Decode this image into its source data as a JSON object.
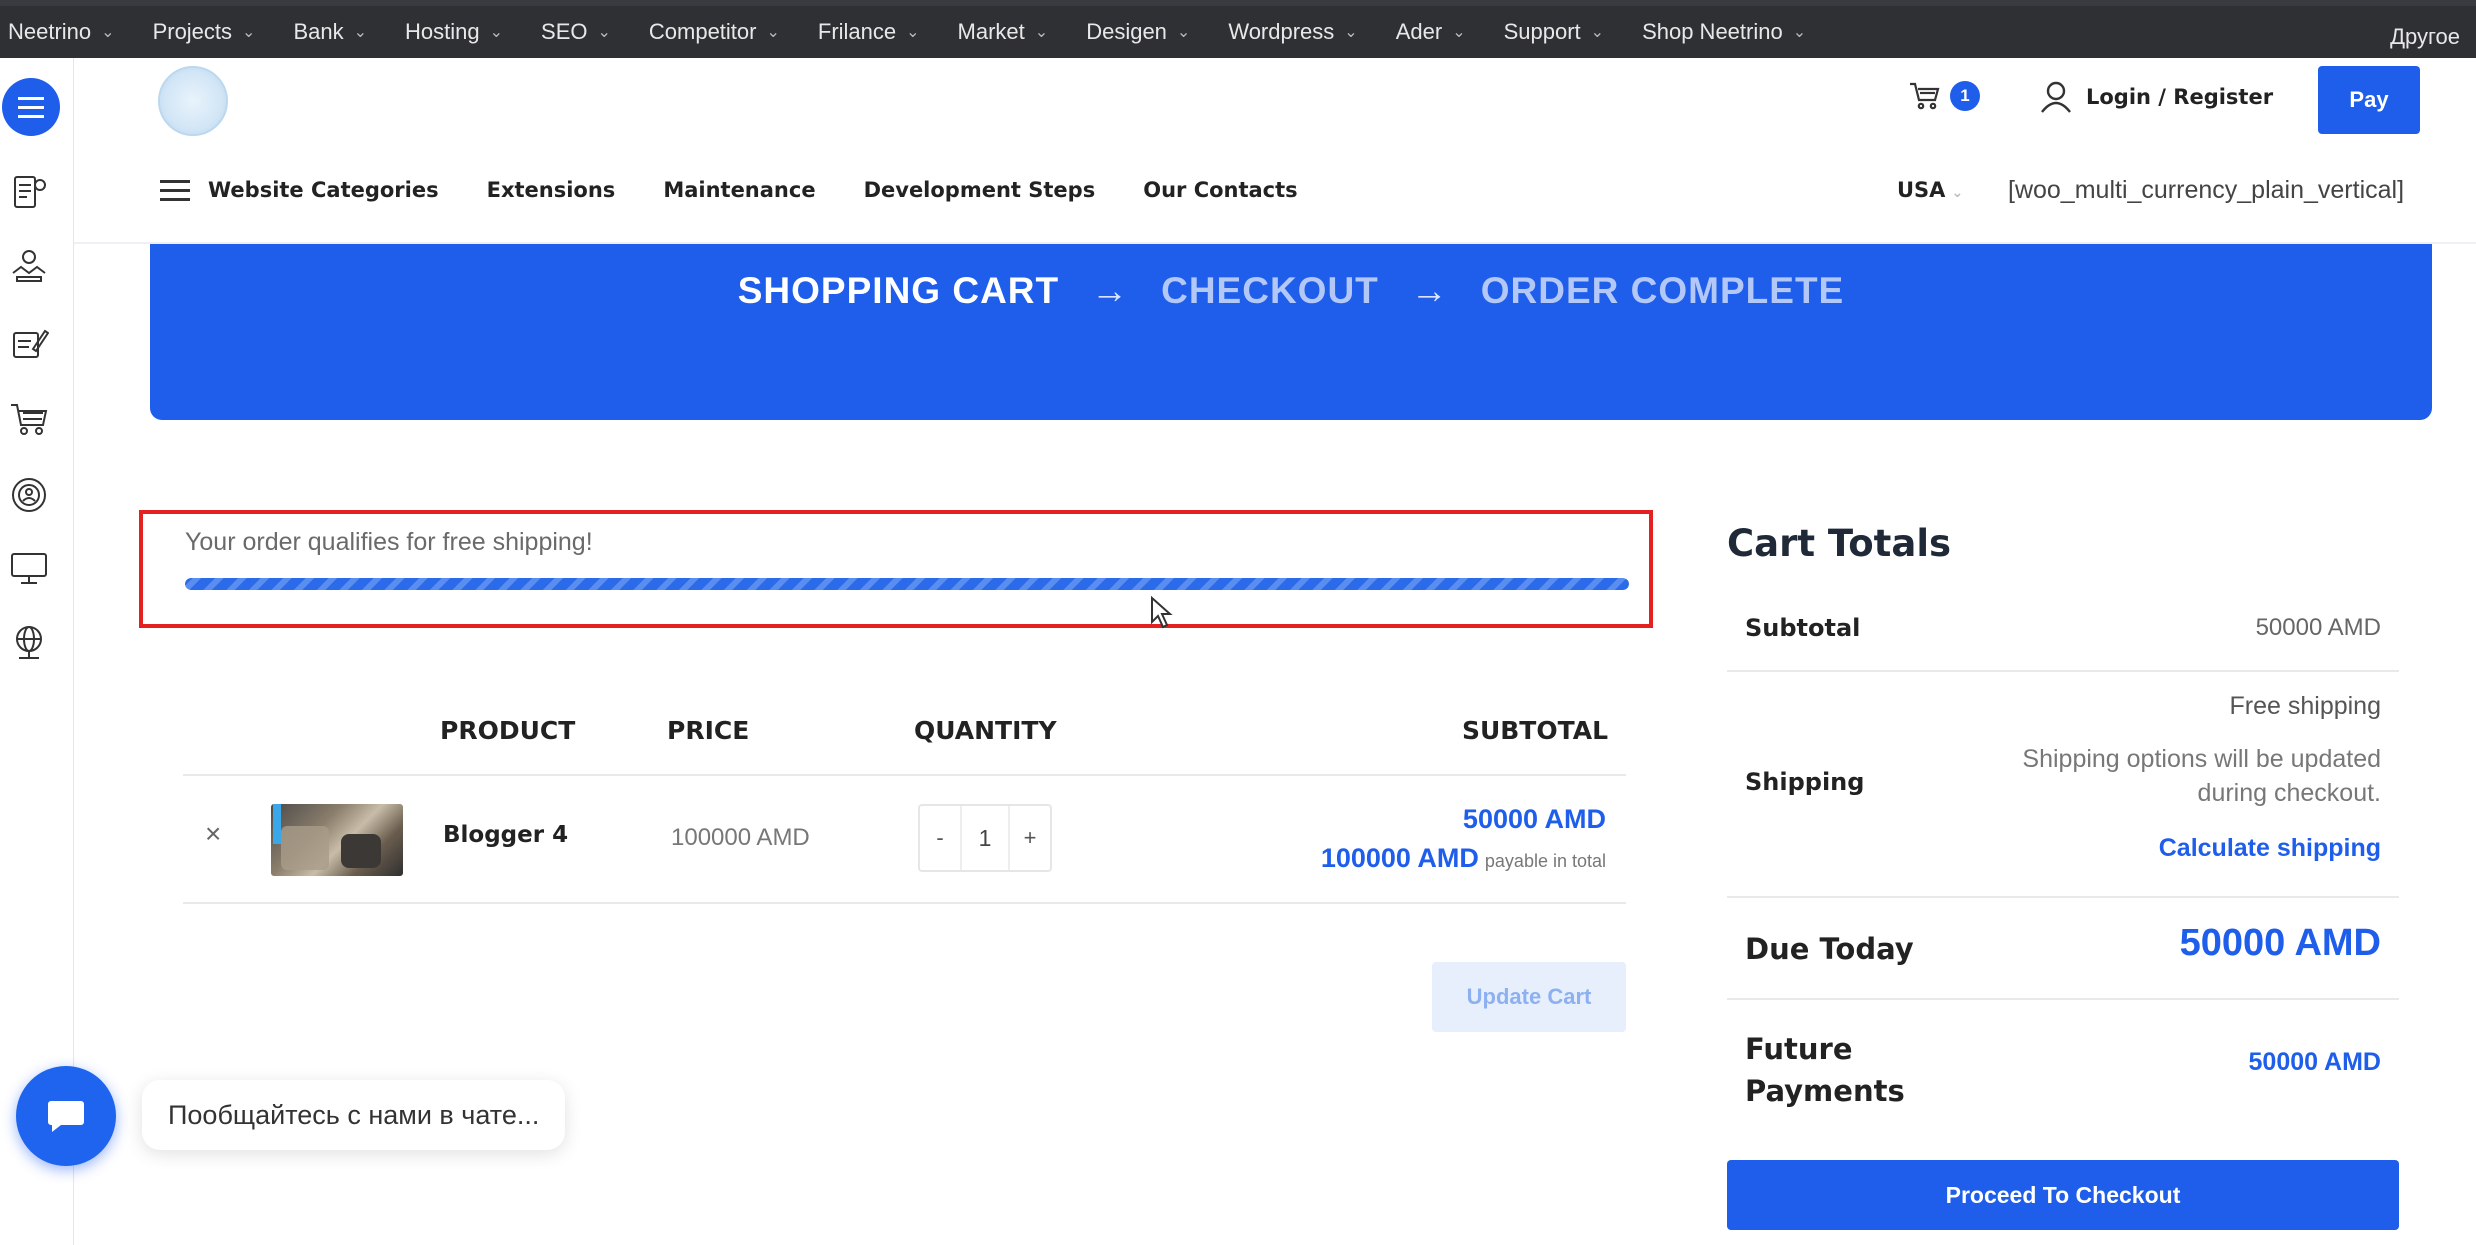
{
  "admin_bar": {
    "items": [
      {
        "label": "Neetrino"
      },
      {
        "label": "Projects"
      },
      {
        "label": "Bank"
      },
      {
        "label": "Hosting"
      },
      {
        "label": "SEO"
      },
      {
        "label": "Competitor"
      },
      {
        "label": "Frilance"
      },
      {
        "label": "Market"
      },
      {
        "label": "Desigen"
      },
      {
        "label": "Wordpress"
      },
      {
        "label": "Ader"
      },
      {
        "label": "Support"
      },
      {
        "label": "Shop Neetrino"
      }
    ],
    "right_label": "Другое"
  },
  "header": {
    "cart_count": "1",
    "login_label": "Login / Register",
    "pay_label": "Pay",
    "nav": {
      "categories": "Website Categories",
      "extensions": "Extensions",
      "maintenance": "Maintenance",
      "development_steps": "Development Steps",
      "contacts": "Our Contacts"
    },
    "country": "USA",
    "currency_shortcode": "[woo_multi_currency_plain_vertical]"
  },
  "steps": {
    "cart": "SHOPPING CART",
    "arrow": "→",
    "checkout": "CHECKOUT",
    "complete": "ORDER COMPLETE"
  },
  "notice": {
    "text": "Your order qualifies for free shipping!",
    "progress_percent": 100
  },
  "table": {
    "headers": {
      "product": "PRODUCT",
      "price": "PRICE",
      "quantity": "QUANTITY",
      "subtotal": "SUBTOTAL"
    },
    "rows": [
      {
        "remove": "×",
        "name": "Blogger 4",
        "price": "100000 AMD",
        "qty_minus": "-",
        "qty": "1",
        "qty_plus": "+",
        "subtotal": "50000 AMD",
        "total": "100000 AMD",
        "total_note": "payable in total"
      }
    ],
    "update_label": "Update Cart"
  },
  "totals": {
    "title": "Cart Totals",
    "subtotal_label": "Subtotal",
    "subtotal_value": "50000 AMD",
    "shipping_label": "Shipping",
    "shipping_value": "Free shipping",
    "shipping_note": "Shipping options will be updated during checkout.",
    "calc_link": "Calculate shipping",
    "due_label": "Due Today",
    "due_value": "50000 AMD",
    "future_label": "Future Payments",
    "future_value": "50000 AMD",
    "checkout_label": "Proceed To Checkout"
  },
  "chat": {
    "bubble_text": "Пообщайтесь с нами в чате..."
  },
  "icons": {
    "sidebar": [
      "menu-icon",
      "document-icon",
      "handshake-icon",
      "contract-icon",
      "cart-icon",
      "target-icon",
      "monitor-icon",
      "globe-icon"
    ]
  },
  "colors": {
    "accent": "#1e5eea",
    "notice_border": "#e52020"
  }
}
